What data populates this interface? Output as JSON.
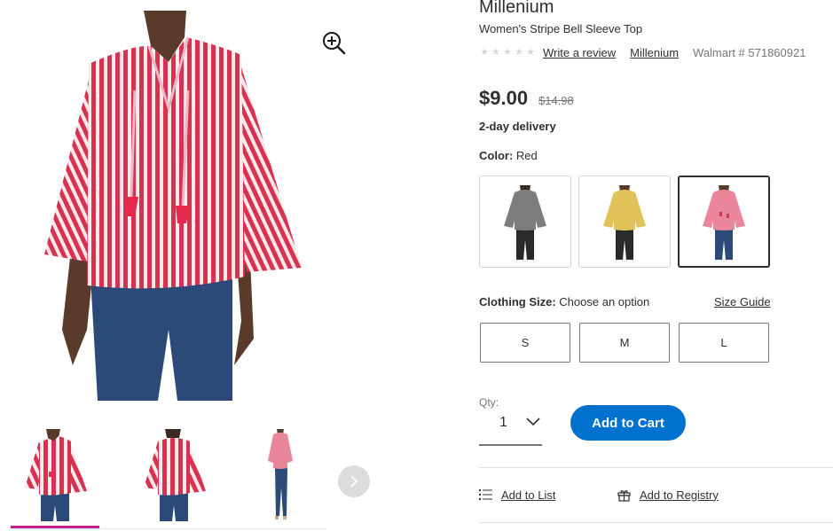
{
  "product": {
    "brand": "Millenium",
    "title": "Women's Stripe Bell Sleeve Top",
    "rating_stars": 5,
    "write_review": "Write a review",
    "brand_link": "Millenium",
    "item_number": "Walmart # 571860921",
    "price": "$9.00",
    "was_price": "$14.98",
    "delivery": "2-day delivery"
  },
  "color": {
    "label": "Color:",
    "value": "Red",
    "options": [
      {
        "color": "#7d7d7d"
      },
      {
        "color": "#e2c35a"
      },
      {
        "color": "#e9869c"
      }
    ],
    "selected_index": 2
  },
  "size": {
    "label": "Clothing Size:",
    "prompt": "Choose an option",
    "guide": "Size Guide",
    "options": [
      "S",
      "M",
      "L"
    ]
  },
  "qty": {
    "label": "Qty:",
    "value": "1"
  },
  "actions": {
    "add_to_cart": "Add to Cart",
    "add_to_list": "Add to List",
    "add_to_registry": "Add to Registry"
  },
  "colors": {
    "accent_blue": "#0071ce",
    "thumb_indicator": "#c21f8e",
    "stripe_red": "#d7324f"
  },
  "icons": {
    "zoom": "zoom-in-icon",
    "next": "chevron-right-icon",
    "qty": "chevron-down-icon",
    "list": "list-icon",
    "registry": "gift-icon"
  }
}
